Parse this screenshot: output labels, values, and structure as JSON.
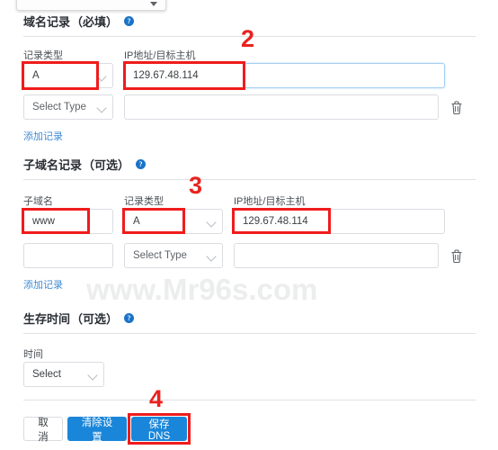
{
  "watermark": "www.Mr96s.com",
  "top_partial_select": {
    "value": "",
    "icon": "chevron-down-icon"
  },
  "sections": {
    "domain_records": {
      "title": "域名记录",
      "required_tag": "（必填）",
      "help_icon": "help-circle-icon",
      "columns": {
        "record_type": "记录类型",
        "ip_host": "IP地址/目标主机"
      },
      "rows": [
        {
          "type_value": "A",
          "ip_value": "129.67.48.114",
          "ip_placeholder": "",
          "has_delete": false
        },
        {
          "type_value": "Select Type",
          "type_is_placeholder": true,
          "ip_value": "",
          "ip_placeholder": "",
          "has_delete": true
        }
      ],
      "add_link": "添加记录"
    },
    "subdomain_records": {
      "title": "子域名记录",
      "required_tag": "（可选）",
      "help_icon": "help-circle-icon",
      "columns": {
        "subdomain": "子域名",
        "record_type": "记录类型",
        "ip_host": "IP地址/目标主机"
      },
      "rows": [
        {
          "sub_value": "www",
          "type_value": "A",
          "ip_value": "129.67.48.114",
          "has_delete": false
        },
        {
          "sub_value": "",
          "type_value": "Select Type",
          "type_is_placeholder": true,
          "ip_value": "",
          "has_delete": true
        }
      ],
      "add_link": "添加记录"
    },
    "ttl": {
      "title": "生存时间",
      "required_tag": "（可选）",
      "help_icon": "help-circle-icon",
      "columns": {
        "time": "时间"
      },
      "select_value": "Select"
    }
  },
  "footer": {
    "cancel_label": "取消",
    "clear_label": "清除设置",
    "save_label": "保存DNS"
  },
  "annotations": {
    "step2": "2",
    "step3": "3",
    "step4": "4"
  },
  "colors": {
    "accent_blue": "#1a86d9",
    "link_blue": "#3f8bd6",
    "highlight_red": "#ef1c1c",
    "annotation_red": "#e8231f",
    "border_gray": "#dadce0"
  }
}
